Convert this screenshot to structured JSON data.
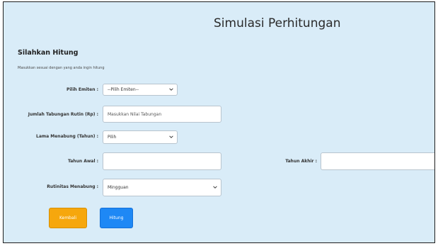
{
  "page": {
    "title": "Simulasi Perhitungan",
    "heading": "Silahkan Hitung",
    "subtitle": "Masukkan sesuai dengan yang anda ingin hitung"
  },
  "form": {
    "emiten": {
      "label": "Pilih Emiten :",
      "value": "--Pilih Emiten--"
    },
    "tabungan": {
      "label": "Jumlah Tabungan Rutin (Rp) :",
      "placeholder": "Masukkan Nilai Tabungan"
    },
    "lama": {
      "label": "Lama Menabung (Tahun) :",
      "value": "Pilih"
    },
    "tahun_awal": {
      "label": "Tahun Awal :",
      "value": ""
    },
    "tahun_akhir": {
      "label": "Tahun Akhir :",
      "value": ""
    },
    "rutinitas": {
      "label": "Rutinitas Menabung :",
      "value": "Mingguan"
    }
  },
  "buttons": {
    "back": "Kembali",
    "calculate": "Hitung"
  },
  "colors": {
    "background": "#d9ecf8",
    "back_button": "#f6a70d",
    "calculate_button": "#1e88f5"
  },
  "icons": {
    "select_arrow": "chevron-down-icon"
  }
}
